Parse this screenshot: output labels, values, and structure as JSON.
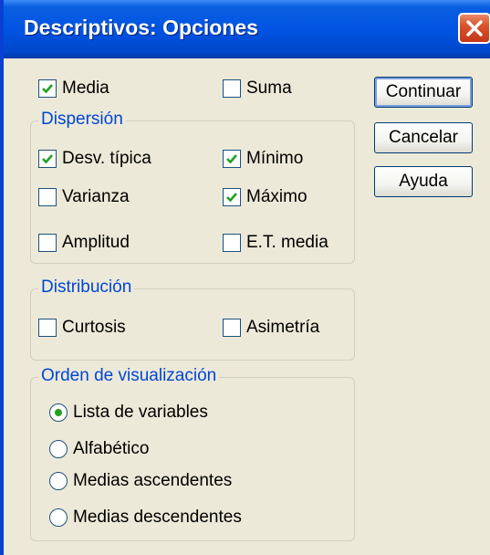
{
  "window": {
    "title": "Descriptivos: Opciones"
  },
  "top_options": {
    "mean": {
      "label": "Media",
      "checked": true
    },
    "sum": {
      "label": "Suma",
      "checked": false
    }
  },
  "dispersion": {
    "title": "Dispersión",
    "std_dev": {
      "label": "Desv. típica",
      "checked": true
    },
    "minimum": {
      "label": "Mínimo",
      "checked": true
    },
    "variance": {
      "label": "Varianza",
      "checked": false
    },
    "maximum": {
      "label": "Máximo",
      "checked": true
    },
    "range": {
      "label": "Amplitud",
      "checked": false
    },
    "se_mean": {
      "label": "E.T. media",
      "checked": false
    }
  },
  "distribution": {
    "title": "Distribución",
    "kurtosis": {
      "label": "Curtosis",
      "checked": false
    },
    "skewness": {
      "label": "Asimetría",
      "checked": false
    }
  },
  "display_order": {
    "title": "Orden de visualización",
    "options": [
      {
        "label": "Lista de variables",
        "selected": true
      },
      {
        "label": "Alfabético",
        "selected": false
      },
      {
        "label": "Medias ascendentes",
        "selected": false
      },
      {
        "label": "Medias descendentes",
        "selected": false
      }
    ]
  },
  "buttons": {
    "continue": "Continuar",
    "cancel": "Cancelar",
    "help": "Ayuda"
  },
  "colors": {
    "titlebar": "#0054e3",
    "group_title": "#0046d5",
    "check": "#21a121",
    "close": "#d9542b"
  }
}
